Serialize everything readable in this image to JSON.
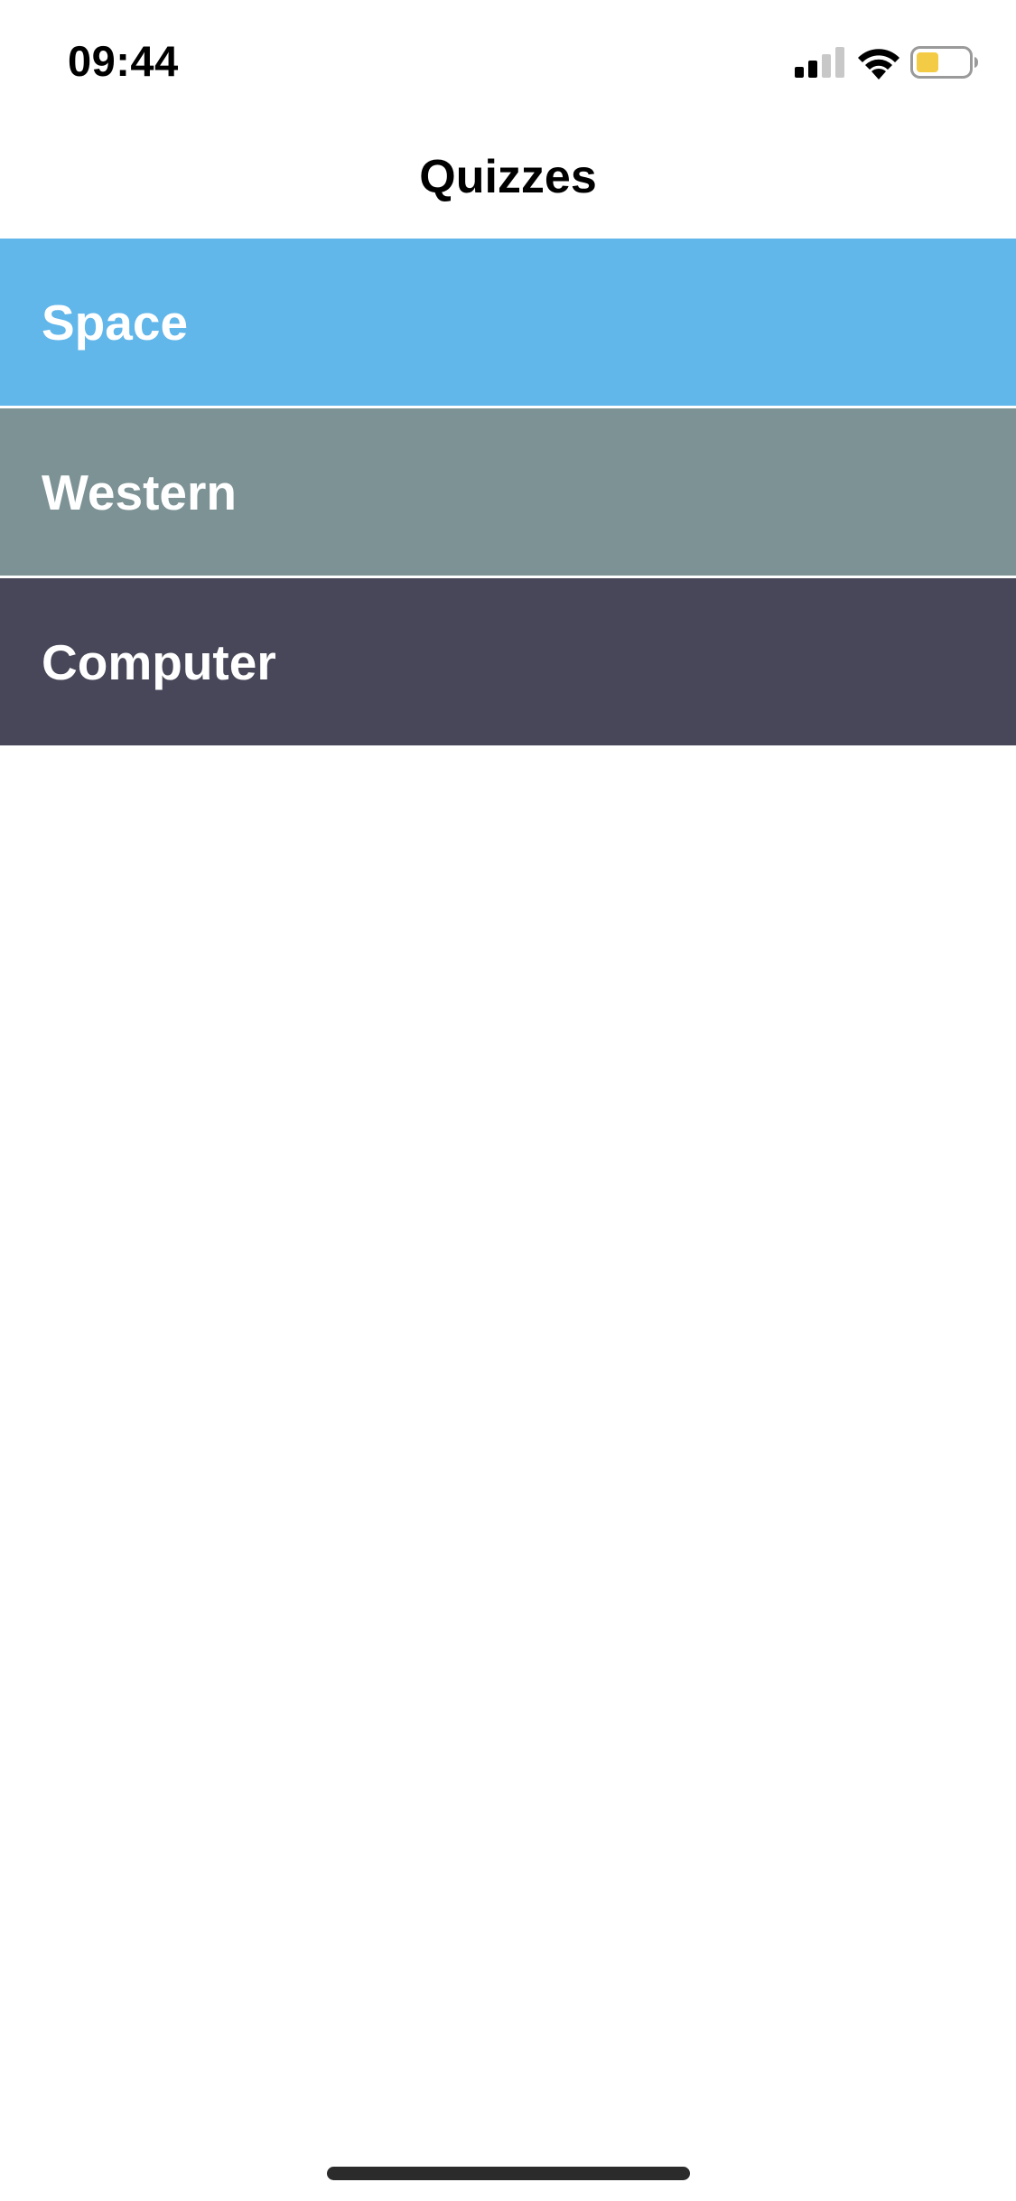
{
  "status_bar": {
    "time": "09:44",
    "battery_color": "#F4CB45",
    "signal_icon": "cellular-signal-icon",
    "wifi_icon": "wifi-icon",
    "battery_icon": "battery-icon"
  },
  "nav": {
    "title": "Quizzes"
  },
  "quizzes": [
    {
      "label": "Space",
      "color": "#61B6EA"
    },
    {
      "label": "Western",
      "color": "#7D9295"
    },
    {
      "label": "Computer",
      "color": "#484759"
    }
  ]
}
